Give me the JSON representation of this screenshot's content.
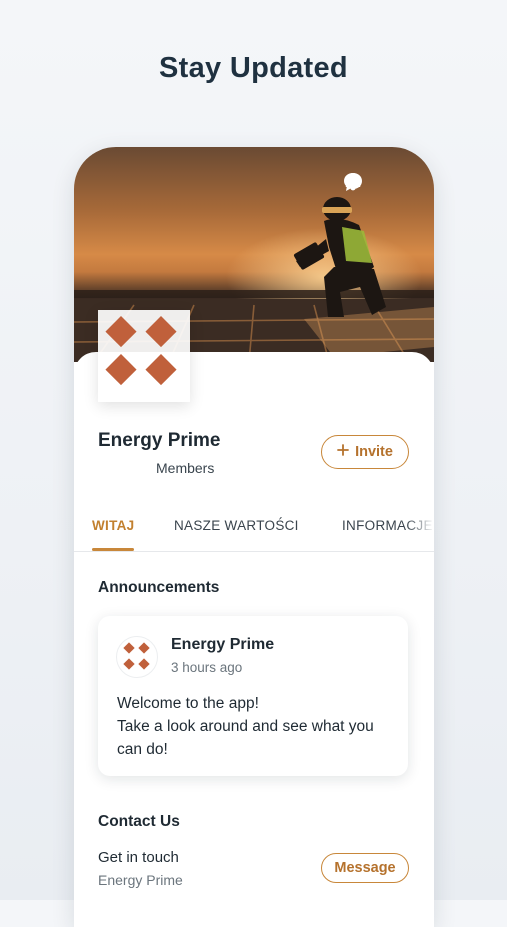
{
  "headline": "Stay Updated",
  "hero": {
    "image_alt": "Worker in hard hat with tablet on a rooftop at sunset",
    "icons": [
      "chat-bubble-icon",
      "bell-icon"
    ]
  },
  "group": {
    "name": "Energy Prime",
    "members_label": "Members",
    "invite_label": "Invite",
    "accent_color": "#c8873a",
    "logo_color": "#c0603b"
  },
  "tabs": [
    {
      "label": "WITAJ",
      "active": true
    },
    {
      "label": "NASZE WARTOŚCI",
      "active": false
    },
    {
      "label": "INFORMACJE",
      "active": false
    }
  ],
  "announcements": {
    "title": "Announcements",
    "post": {
      "author": "Energy Prime",
      "time": "3 hours ago",
      "body_line1": "Welcome to the app!",
      "body_line2": "Take a look around and see what you can do!"
    }
  },
  "contact": {
    "title": "Contact Us",
    "line1": "Get in touch",
    "line2": "Energy Prime",
    "message_label": "Message"
  }
}
